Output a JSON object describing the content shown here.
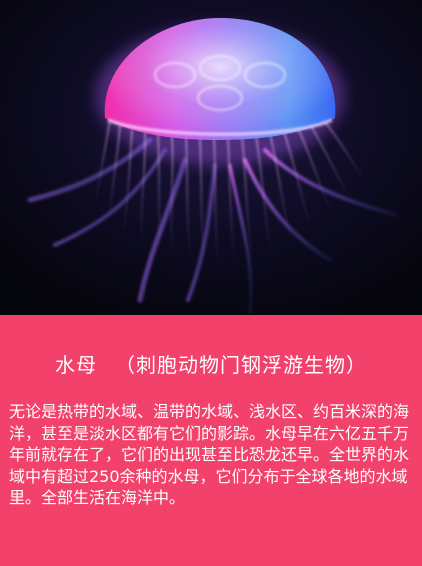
{
  "title": {
    "main": "水母",
    "classification": "（刺胞动物门钢浮游生物）"
  },
  "description": "无论是热带的水域、温带的水域、浅水区、约百米深的海洋，甚至是淡水区都有它们的影踪。水母早在六亿五千万年前就存在了，它们的出现甚至比恐龙还早。全世界的水域中有超过250余种的水母，它们分布于全球各地的水域里。全部生活在海洋中。",
  "colors": {
    "panel": "#f2426c",
    "photo_background": "#0a0a18",
    "text": "#ffffff"
  }
}
